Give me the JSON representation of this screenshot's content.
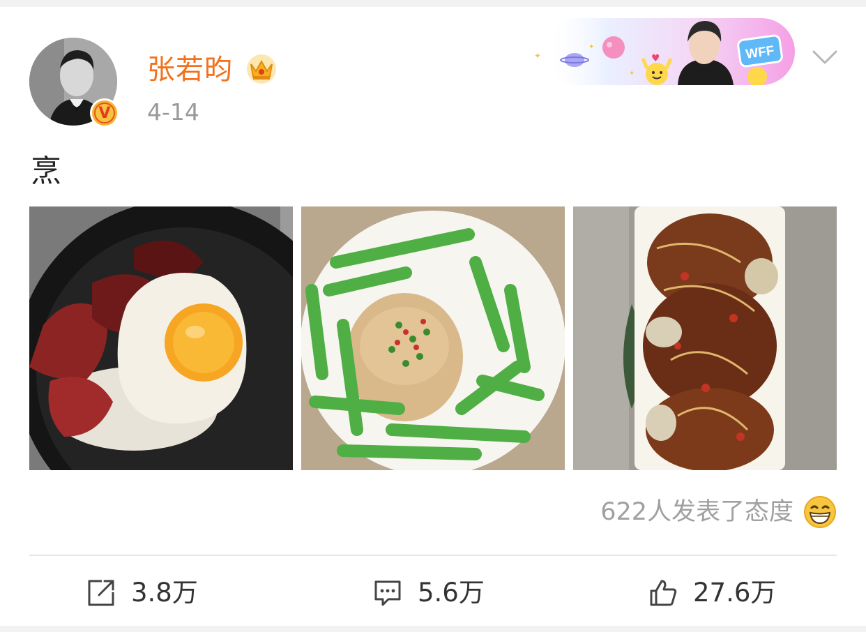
{
  "post": {
    "username": "张若昀",
    "time": "4-14",
    "text": "烹"
  },
  "banner": {
    "badge_text": "WFF"
  },
  "photos": [
    {
      "name": "steak-egg-rice-photo"
    },
    {
      "name": "snow-peas-photo"
    },
    {
      "name": "fried-dish-photo"
    }
  ],
  "reactions": {
    "text": "622人发表了态度"
  },
  "actions": {
    "repost_count": "3.8万",
    "comment_count": "5.6万",
    "like_count": "27.6万"
  },
  "colors": {
    "username": "#f2711c",
    "muted": "#999999",
    "text": "#222222"
  }
}
